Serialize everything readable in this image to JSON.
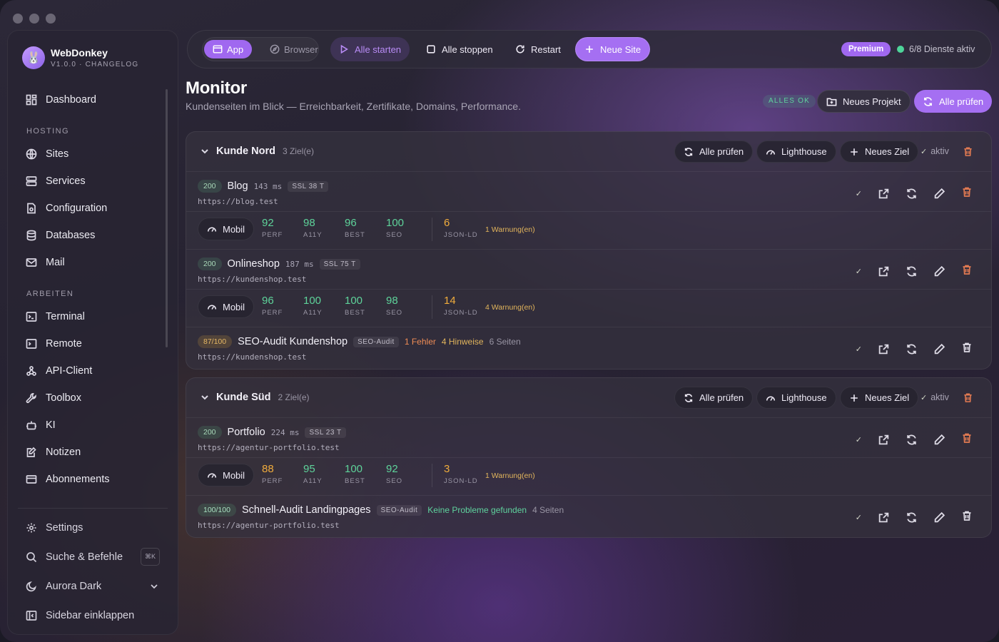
{
  "app": {
    "name": "WebDonkey",
    "version": "V1.0.0 · CHANGELOG"
  },
  "sidebar": {
    "top_item": "Dashboard",
    "sections": [
      {
        "title": "HOSTING",
        "items": [
          "Sites",
          "Services",
          "Configuration",
          "Databases",
          "Mail"
        ]
      },
      {
        "title": "ARBEITEN",
        "items": [
          "Terminal",
          "Remote",
          "API-Client",
          "Toolbox",
          "KI",
          "Notizen",
          "Abonnements"
        ]
      }
    ],
    "bottom": {
      "settings": "Settings",
      "search": "Suche & Befehle",
      "search_kbd": "⌘K",
      "theme": "Aurora Dark",
      "collapse": "Sidebar einklappen"
    }
  },
  "toolbar": {
    "mode_app": "App",
    "mode_browser": "Browser",
    "start_all": "Alle starten",
    "stop_all": "Alle stoppen",
    "restart": "Restart",
    "new_site": "Neue Site",
    "premium": "Premium",
    "status": "6/8 Dienste aktiv"
  },
  "page": {
    "title": "Monitor",
    "subtitle": "Kundenseiten im Blick — Erreichbarkeit, Zertifikate, Domains, Performance.",
    "badge": "ALLES OK",
    "new_project": "Neues Projekt",
    "check_all": "Alle prüfen"
  },
  "group_buttons": {
    "check_all": "Alle prüfen",
    "lighthouse": "Lighthouse",
    "new_target": "Neues Ziel",
    "active": "aktiv",
    "check_mark": "✓"
  },
  "groups": [
    {
      "name": "Kunde Nord",
      "count": "3 Ziel(e)",
      "targets": [
        {
          "code": "200",
          "name": "Blog",
          "ms": "143 ms",
          "ssl": "SSL 38 T",
          "url": "https://blog.test",
          "mobil": "Mobil",
          "metrics": [
            {
              "value": "92",
              "label": "PERF"
            },
            {
              "value": "98",
              "label": "A11Y"
            },
            {
              "value": "96",
              "label": "BEST"
            },
            {
              "value": "100",
              "label": "SEO"
            }
          ],
          "jsonld": {
            "value": "6",
            "label": "JSON-LD"
          },
          "warnings": "1 Warnung(en)"
        },
        {
          "code": "200",
          "name": "Onlineshop",
          "ms": "187 ms",
          "ssl": "SSL 75 T",
          "url": "https://kundenshop.test",
          "mobil": "Mobil",
          "metrics": [
            {
              "value": "96",
              "label": "PERF"
            },
            {
              "value": "100",
              "label": "A11Y"
            },
            {
              "value": "100",
              "label": "BEST"
            },
            {
              "value": "98",
              "label": "SEO"
            }
          ],
          "jsonld": {
            "value": "14",
            "label": "JSON-LD"
          },
          "warnings": "4 Warnung(en)"
        },
        {
          "code": "87/100",
          "name": "SEO-Audit Kundenshop",
          "tag": "SEO-Audit",
          "errors": "1 Fehler",
          "hints": "4 Hinweise",
          "pages": "6 Seiten",
          "url": "https://kundenshop.test"
        }
      ]
    },
    {
      "name": "Kunde Süd",
      "count": "2 Ziel(e)",
      "targets": [
        {
          "code": "200",
          "name": "Portfolio",
          "ms": "224 ms",
          "ssl": "SSL 23 T",
          "url": "https://agentur-portfolio.test",
          "mobil": "Mobil",
          "metrics": [
            {
              "value": "88",
              "label": "PERF"
            },
            {
              "value": "95",
              "label": "A11Y"
            },
            {
              "value": "100",
              "label": "BEST"
            },
            {
              "value": "92",
              "label": "SEO"
            }
          ],
          "jsonld": {
            "value": "3",
            "label": "JSON-LD"
          },
          "warnings": "1 Warnung(en)"
        },
        {
          "code": "100/100",
          "name": "Schnell-Audit Landingpages",
          "tag": "SEO-Audit",
          "ok": "Keine Probleme gefunden",
          "pages": "4 Seiten",
          "url": "https://agentur-portfolio.test"
        }
      ]
    }
  ],
  "colors": {
    "accent": "#a56ff2",
    "ok": "#5ed39a",
    "warn": "#f0ac3c",
    "danger": "#e27a52"
  }
}
